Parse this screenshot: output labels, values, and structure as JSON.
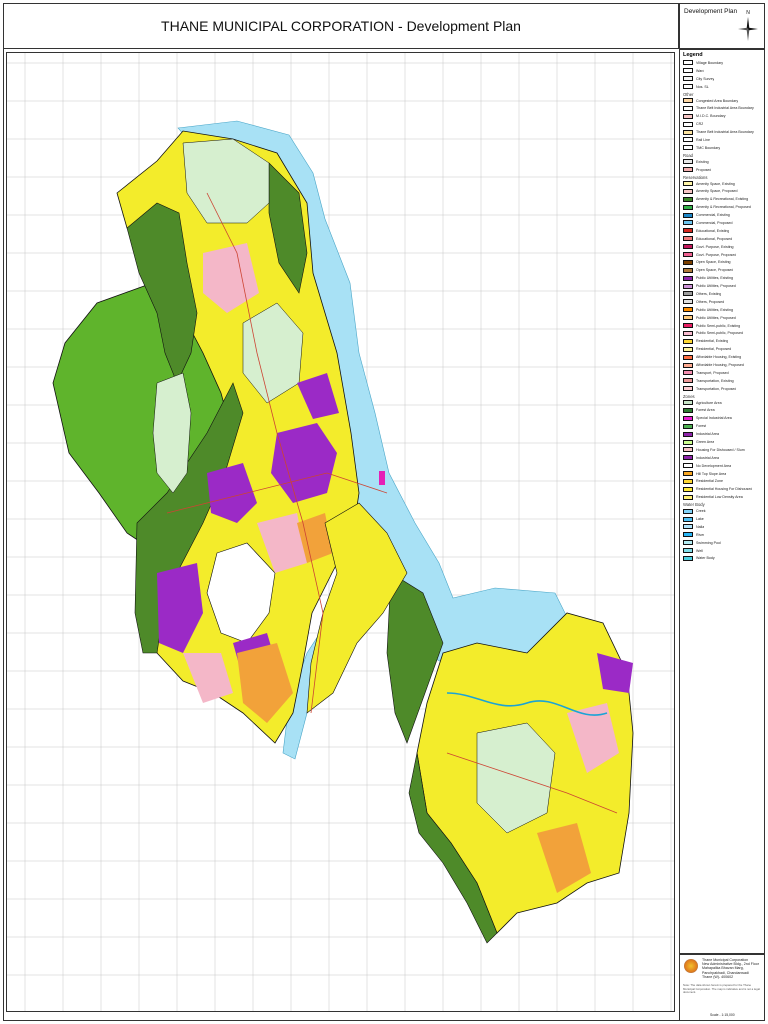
{
  "title": "THANE MUNICIPAL CORPORATION - Development Plan",
  "corner": {
    "label": "Development Plan",
    "north": "N"
  },
  "legend": {
    "title": "Legend",
    "groups": [
      {
        "label": "",
        "items": [
          {
            "text": "Village Boundary",
            "color": "#ffffff"
          },
          {
            "text": "Ward",
            "color": "#ffffff"
          },
          {
            "text": "City Survey",
            "color": "#f5f5f5"
          },
          {
            "text": "Nos. SL",
            "color": "#ffffff"
          }
        ]
      },
      {
        "label": "Other",
        "items": [
          {
            "text": "Congested Area Boundary",
            "color": "#ffd9a6"
          },
          {
            "text": "Thane Belt Industrial Area Boundary",
            "color": "#ffffff"
          },
          {
            "text": "M.I.D.C. Boundary",
            "color": "#f7c6c6"
          },
          {
            "text": "CRZ",
            "color": "#ffffff"
          },
          {
            "text": "Thane Belt Industrial Area Boundary",
            "color": "#fde4a0"
          },
          {
            "text": "Rail Line",
            "color": "#ffffff"
          },
          {
            "text": "TMC Boundary",
            "color": "#ffffff"
          }
        ]
      },
      {
        "label": "Road",
        "items": [
          {
            "text": "Existing",
            "color": "#e8e8e8"
          },
          {
            "text": "Proposed",
            "color": "#f4b0b0"
          }
        ]
      },
      {
        "label": "Reservations",
        "items": [
          {
            "text": "Amenity Space, Existing",
            "color": "#fff6a8"
          },
          {
            "text": "Amenity Space, Proposed",
            "color": "#f7c6c6"
          },
          {
            "text": "Amenity & Recreational, Existing",
            "color": "#3d8a2a"
          },
          {
            "text": "Amenity & Recreational, Proposed",
            "color": "#35b24a"
          },
          {
            "text": "Commercial, Existing",
            "color": "#1e88c8"
          },
          {
            "text": "Commercial, Proposed",
            "color": "#6ec6f0"
          },
          {
            "text": "Educational, Existing",
            "color": "#d6281e"
          },
          {
            "text": "Educational, Proposed",
            "color": "#f27a7a"
          },
          {
            "text": "Govt. Purpose, Existing",
            "color": "#c2185b"
          },
          {
            "text": "Govt. Purpose, Proposed",
            "color": "#f06292"
          },
          {
            "text": "Open Space, Existing",
            "color": "#7b3f00"
          },
          {
            "text": "Open Space, Proposed",
            "color": "#b07a3a"
          },
          {
            "text": "Public Utilities, Existing",
            "color": "#8e24aa"
          },
          {
            "text": "Public Utilities, Proposed",
            "color": "#ce93d8"
          },
          {
            "text": "Others, Existing",
            "color": "#9e9e9e"
          },
          {
            "text": "Others, Proposed",
            "color": "#e0e0e0"
          },
          {
            "text": "Public Utilities, Existing",
            "color": "#ff8f00"
          },
          {
            "text": "Public Utilities, Proposed",
            "color": "#ffcc80"
          },
          {
            "text": "Public Semi-public, Existing",
            "color": "#e91e63"
          },
          {
            "text": "Public Semi-public, Proposed",
            "color": "#f8bbd0"
          },
          {
            "text": "Residential, Existing",
            "color": "#fdd835"
          },
          {
            "text": "Residential, Proposed",
            "color": "#fff59d"
          },
          {
            "text": "Affordable Housing, Existing",
            "color": "#ff7043"
          },
          {
            "text": "Affordable Housing, Proposed",
            "color": "#ffab91"
          },
          {
            "text": "Transport, Proposed",
            "color": "#f48fb1"
          },
          {
            "text": "Transportation, Existing",
            "color": "#ef9a9a"
          },
          {
            "text": "Transportation, Proposed",
            "color": "#ffcdd2"
          }
        ]
      },
      {
        "label": "Zones",
        "items": [
          {
            "text": "Agriculture Area",
            "color": "#c8e6c9"
          },
          {
            "text": "Forest Area",
            "color": "#2e7d32"
          },
          {
            "text": "Special Industrial Area",
            "color": "#e91ed0"
          },
          {
            "text": "Forest",
            "color": "#4caf50"
          },
          {
            "text": "Industrial Area",
            "color": "#8e24aa"
          },
          {
            "text": "Green Area",
            "color": "#ccff90"
          },
          {
            "text": "Housing For Dishoused / Slum",
            "color": "#f7c6c6"
          },
          {
            "text": "Industrial Area",
            "color": "#8e24aa"
          },
          {
            "text": "No Development Area",
            "color": "#ffffff"
          },
          {
            "text": "Hill Top Slope Area",
            "color": "#f9a825"
          },
          {
            "text": "Residential Zone",
            "color": "#fdd835"
          },
          {
            "text": "Residential Housing For Dishoused",
            "color": "#ffeb3b"
          },
          {
            "text": "Residential Low Density Area",
            "color": "#fff176"
          }
        ]
      },
      {
        "label": "Water Body",
        "items": [
          {
            "text": "Creek",
            "color": "#81d4fa"
          },
          {
            "text": "Lake",
            "color": "#4fc3f7"
          },
          {
            "text": "Nalla",
            "color": "#b3e5fc"
          },
          {
            "text": "River",
            "color": "#29b6f6"
          },
          {
            "text": "Swimming Pool",
            "color": "#b2ebf2"
          },
          {
            "text": "Well",
            "color": "#80deea"
          },
          {
            "text": "Water Body",
            "color": "#4dd0e1"
          }
        ]
      }
    ]
  },
  "info": {
    "org_lines": [
      "Thane Municipal Corporation",
      "New Administrative Bldg., 2nd Floor",
      "Mahapalika Bhavan Marg,",
      "Panchpakhadi, Chandanwadi",
      "Thane (W)- 400602"
    ],
    "note": "Note: The data shown herein is prepared for the Thane Municipal Corporation. The map is indicative and is not a legal document.",
    "scale": "Scale - 1:15,000"
  },
  "colors": {
    "grid": "#c7c7c7",
    "creek": "#a8e1f5",
    "forest_dark": "#4e8a29",
    "forest_green": "#5fb42c",
    "agriculture": "#d6efcf",
    "residential": "#f3ec2b",
    "industrial": "#9b2ac6",
    "pink": "#f4b7c8",
    "orange": "#f2a23a",
    "magenta": "#e520b6",
    "boundary": "#111111"
  }
}
